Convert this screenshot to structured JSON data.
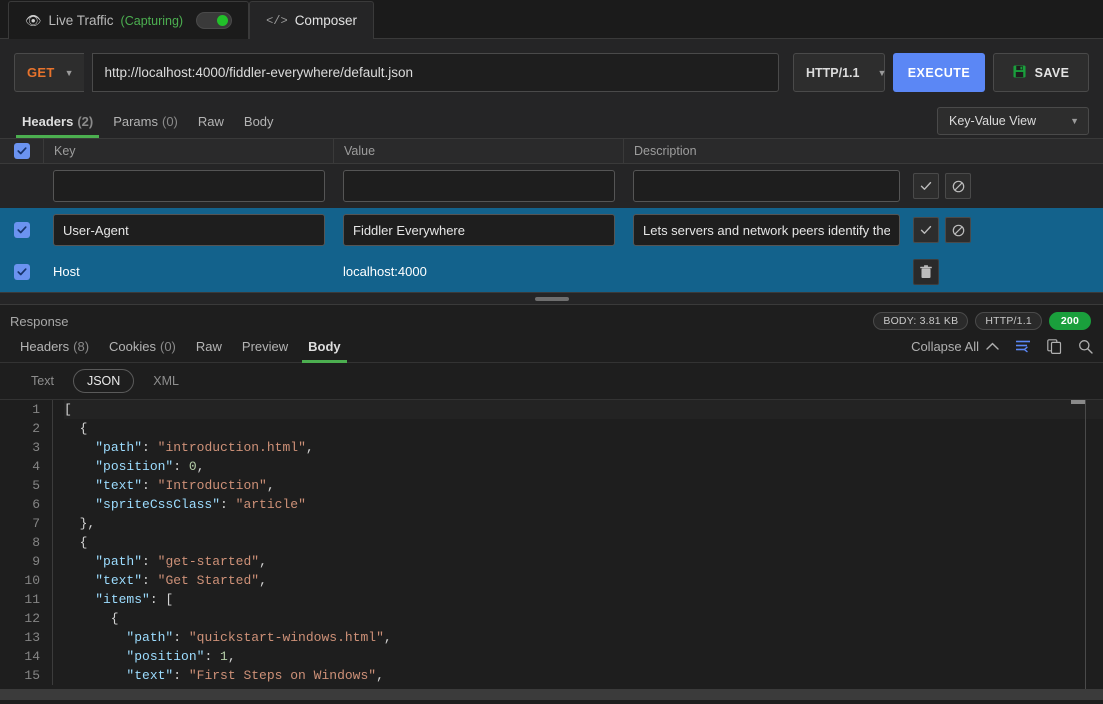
{
  "top_tabs": [
    {
      "label": "Live Traffic",
      "status": "(Capturing)",
      "icon": "eye-icon",
      "toggle_on": true,
      "active": false
    },
    {
      "label": "Composer",
      "icon": "code-icon",
      "active": true
    }
  ],
  "request": {
    "method": "GET",
    "url": "http://localhost:4000/fiddler-everywhere/default.json",
    "http_version": "HTTP/1.1",
    "execute_label": "EXECUTE",
    "save_label": "SAVE",
    "sub_tabs": [
      {
        "label": "Headers",
        "count": "(2)",
        "active": true
      },
      {
        "label": "Params",
        "count": "(0)",
        "active": false
      },
      {
        "label": "Raw",
        "count": "",
        "active": false
      },
      {
        "label": "Body",
        "count": "",
        "active": false
      }
    ],
    "view_mode": "Key-Value View",
    "grid": {
      "columns": [
        "Key",
        "Value",
        "Description"
      ],
      "new_row": {
        "key_placeholder": "",
        "value_placeholder": "",
        "description_placeholder": ""
      },
      "rows": [
        {
          "checked": true,
          "key": "User-Agent",
          "value": "Fiddler Everywhere",
          "description": "Lets servers and network peers identify the ...",
          "selected": true,
          "editing": true
        },
        {
          "checked": true,
          "key": "Host",
          "value": "localhost:4000",
          "description": "",
          "selected": true,
          "editing": false
        }
      ]
    }
  },
  "response": {
    "title": "Response",
    "badges": {
      "body_size": "BODY: 3.81 KB",
      "http_version": "HTTP/1.1",
      "status": "200"
    },
    "tabs": [
      {
        "label": "Headers",
        "count": "(8)",
        "active": false
      },
      {
        "label": "Cookies",
        "count": "(0)",
        "active": false
      },
      {
        "label": "Raw",
        "count": "",
        "active": false
      },
      {
        "label": "Preview",
        "count": "",
        "active": false
      },
      {
        "label": "Body",
        "count": "",
        "active": true
      }
    ],
    "collapse_label": "Collapse All",
    "tools": [
      "wrap-text-icon",
      "copy-icon",
      "search-icon"
    ],
    "formats": [
      {
        "label": "Text",
        "active": false
      },
      {
        "label": "JSON",
        "active": true
      },
      {
        "label": "XML",
        "active": false
      }
    ],
    "body_lines": [
      {
        "no": "1",
        "tokens": [
          {
            "t": "[",
            "c": "p"
          }
        ]
      },
      {
        "no": "2",
        "tokens": [
          {
            "t": "  {",
            "c": "p"
          }
        ]
      },
      {
        "no": "3",
        "tokens": [
          {
            "t": "    ",
            "c": "p"
          },
          {
            "t": "\"path\"",
            "c": "k"
          },
          {
            "t": ": ",
            "c": "p"
          },
          {
            "t": "\"introduction.html\"",
            "c": "s"
          },
          {
            "t": ",",
            "c": "p"
          }
        ]
      },
      {
        "no": "4",
        "tokens": [
          {
            "t": "    ",
            "c": "p"
          },
          {
            "t": "\"position\"",
            "c": "k"
          },
          {
            "t": ": ",
            "c": "p"
          },
          {
            "t": "0",
            "c": "n"
          },
          {
            "t": ",",
            "c": "p"
          }
        ]
      },
      {
        "no": "5",
        "tokens": [
          {
            "t": "    ",
            "c": "p"
          },
          {
            "t": "\"text\"",
            "c": "k"
          },
          {
            "t": ": ",
            "c": "p"
          },
          {
            "t": "\"Introduction\"",
            "c": "s"
          },
          {
            "t": ",",
            "c": "p"
          }
        ]
      },
      {
        "no": "6",
        "tokens": [
          {
            "t": "    ",
            "c": "p"
          },
          {
            "t": "\"spriteCssClass\"",
            "c": "k"
          },
          {
            "t": ": ",
            "c": "p"
          },
          {
            "t": "\"article\"",
            "c": "s"
          }
        ]
      },
      {
        "no": "7",
        "tokens": [
          {
            "t": "  },",
            "c": "p"
          }
        ]
      },
      {
        "no": "8",
        "tokens": [
          {
            "t": "  {",
            "c": "p"
          }
        ]
      },
      {
        "no": "9",
        "tokens": [
          {
            "t": "    ",
            "c": "p"
          },
          {
            "t": "\"path\"",
            "c": "k"
          },
          {
            "t": ": ",
            "c": "p"
          },
          {
            "t": "\"get-started\"",
            "c": "s"
          },
          {
            "t": ",",
            "c": "p"
          }
        ]
      },
      {
        "no": "10",
        "tokens": [
          {
            "t": "    ",
            "c": "p"
          },
          {
            "t": "\"text\"",
            "c": "k"
          },
          {
            "t": ": ",
            "c": "p"
          },
          {
            "t": "\"Get Started\"",
            "c": "s"
          },
          {
            "t": ",",
            "c": "p"
          }
        ]
      },
      {
        "no": "11",
        "tokens": [
          {
            "t": "    ",
            "c": "p"
          },
          {
            "t": "\"items\"",
            "c": "k"
          },
          {
            "t": ": [",
            "c": "p"
          }
        ]
      },
      {
        "no": "12",
        "tokens": [
          {
            "t": "      {",
            "c": "p"
          }
        ]
      },
      {
        "no": "13",
        "tokens": [
          {
            "t": "        ",
            "c": "p"
          },
          {
            "t": "\"path\"",
            "c": "k"
          },
          {
            "t": ": ",
            "c": "p"
          },
          {
            "t": "\"quickstart-windows.html\"",
            "c": "s"
          },
          {
            "t": ",",
            "c": "p"
          }
        ]
      },
      {
        "no": "14",
        "tokens": [
          {
            "t": "        ",
            "c": "p"
          },
          {
            "t": "\"position\"",
            "c": "k"
          },
          {
            "t": ": ",
            "c": "p"
          },
          {
            "t": "1",
            "c": "n"
          },
          {
            "t": ",",
            "c": "p"
          }
        ]
      },
      {
        "no": "15",
        "tokens": [
          {
            "t": "        ",
            "c": "p"
          },
          {
            "t": "\"text\"",
            "c": "k"
          },
          {
            "t": ": ",
            "c": "p"
          },
          {
            "t": "\"First Steps on Windows\"",
            "c": "s"
          },
          {
            "t": ",",
            "c": "p"
          }
        ]
      }
    ]
  },
  "colors": {
    "accent_blue": "#5b87f5",
    "method_orange": "#e8732c",
    "green": "#4caf50",
    "status_green": "#1a9f3c",
    "row_selected": "#13628c",
    "checkbox": "#6b93f0"
  }
}
